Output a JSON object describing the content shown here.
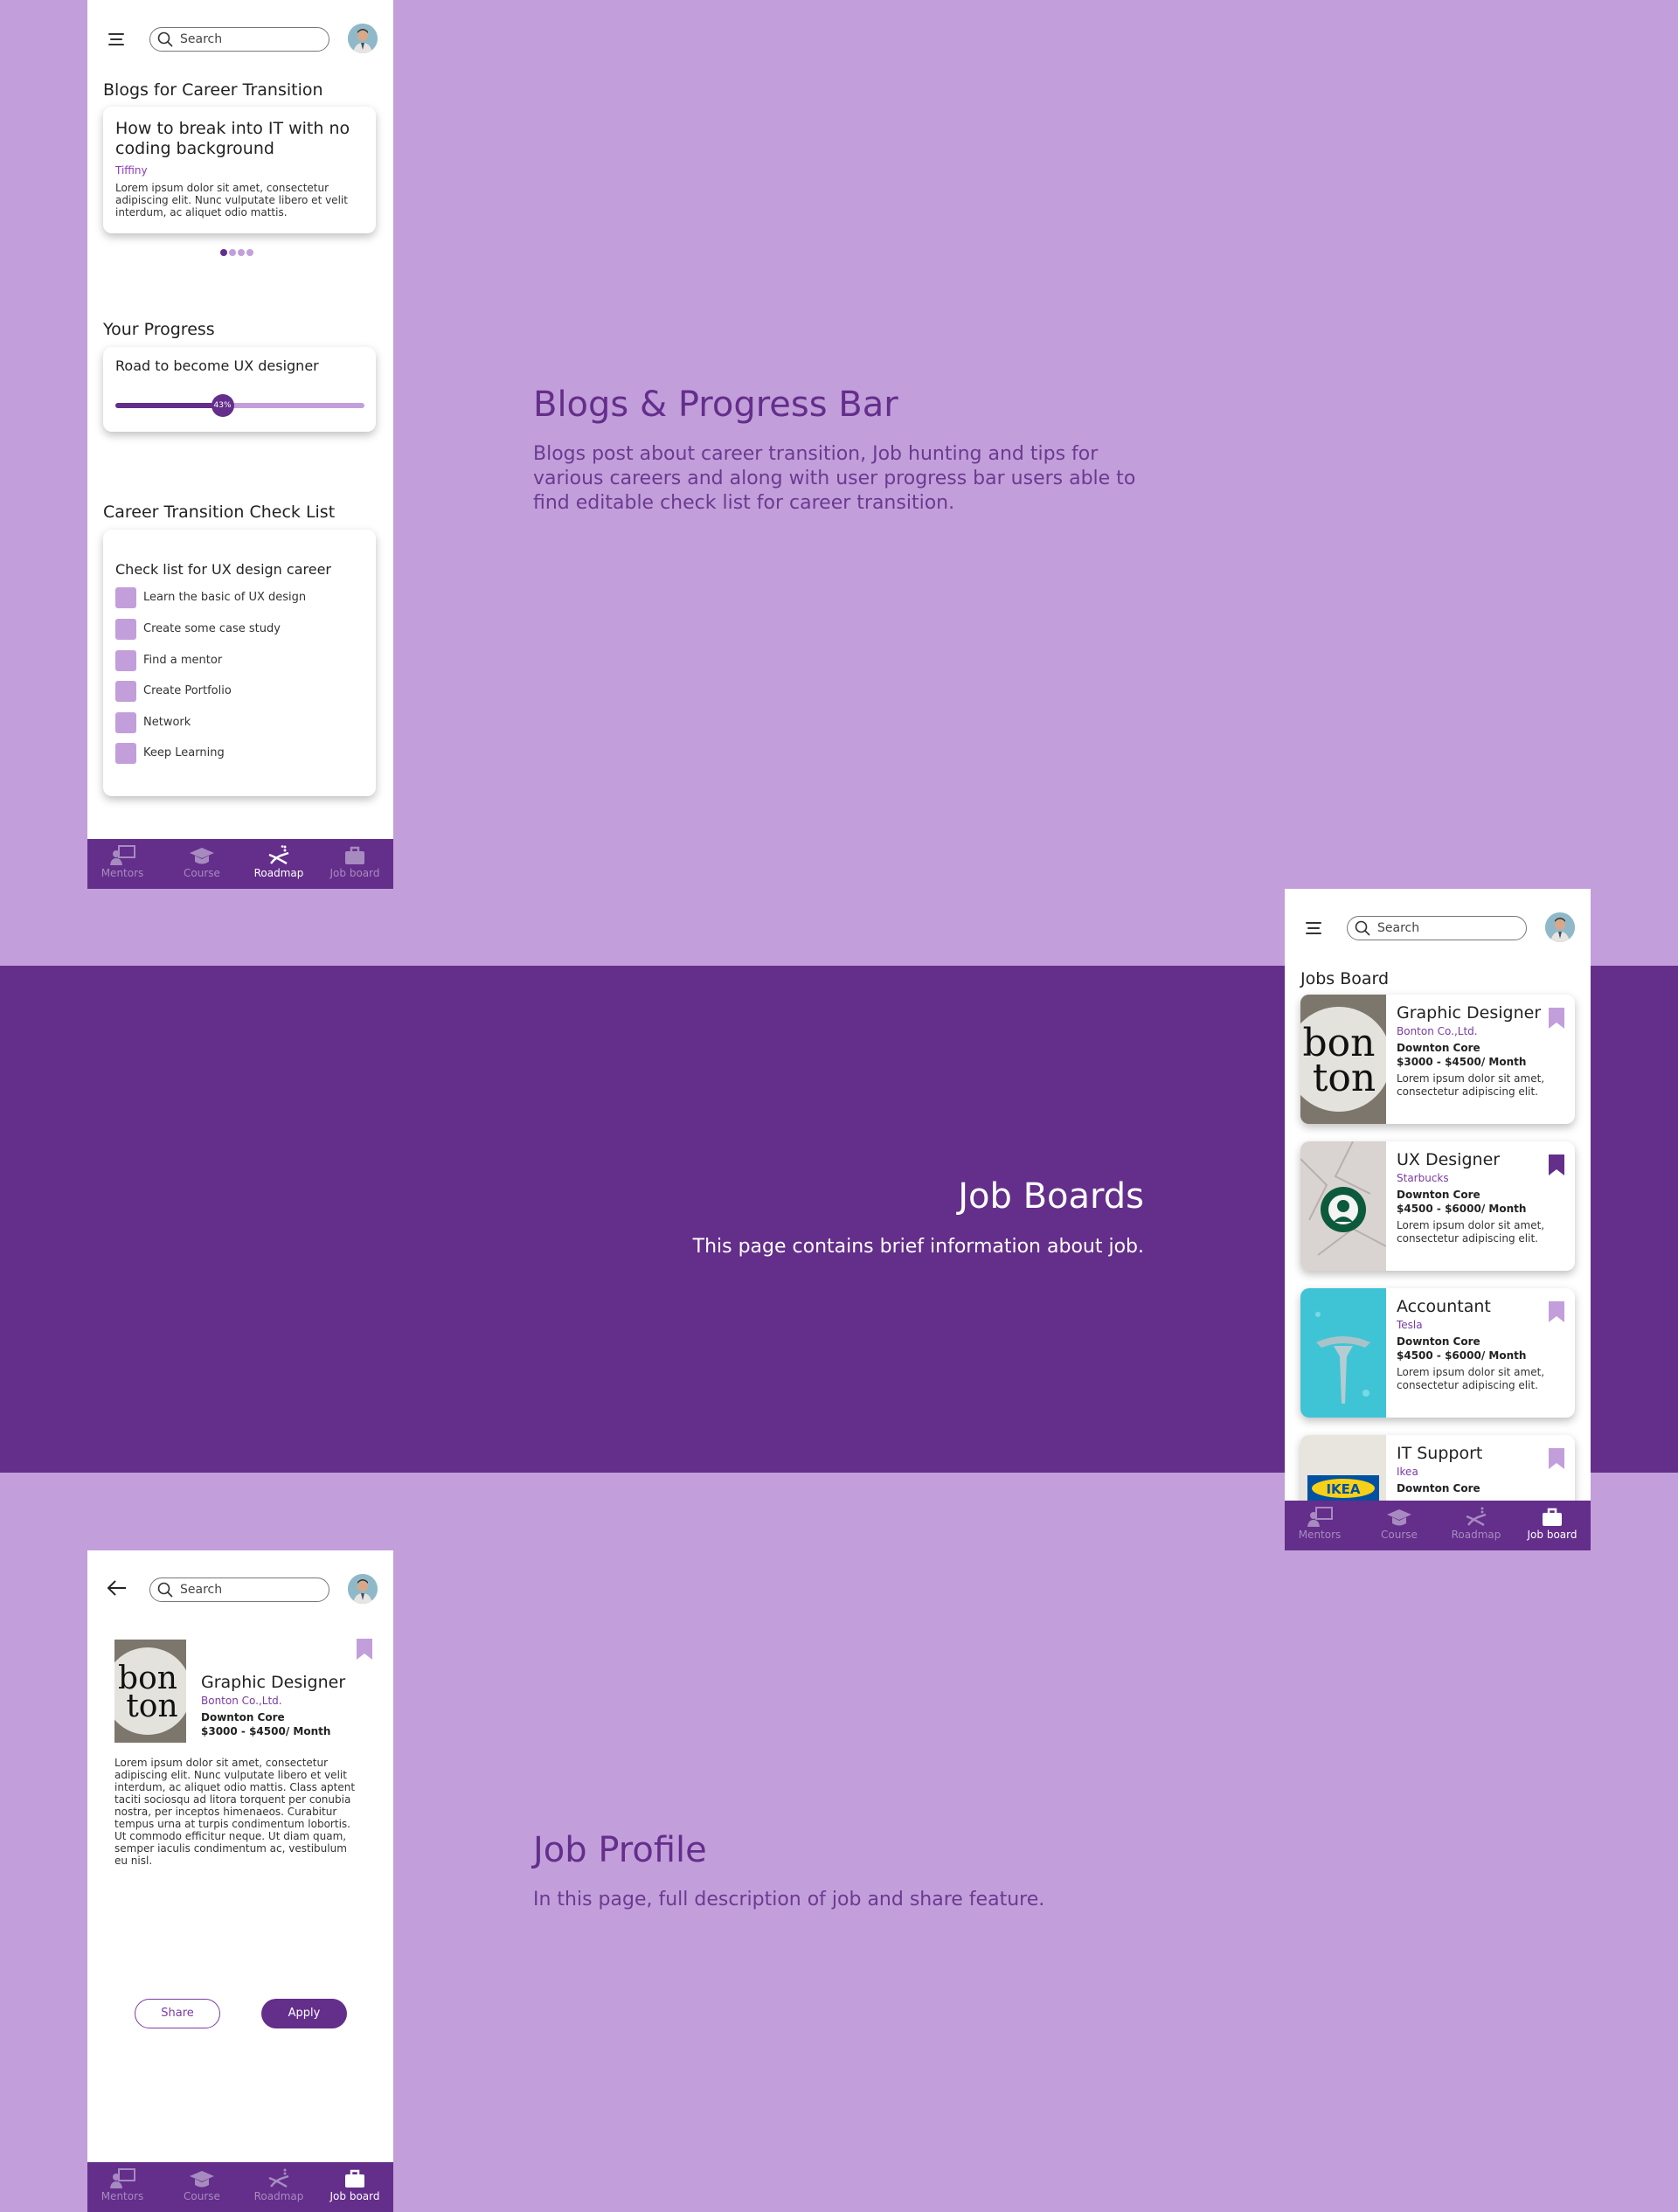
{
  "search_placeholder": "Search",
  "nav": [
    "Mentors",
    "Course",
    "Roadmap",
    "Job board"
  ],
  "section1": {
    "title": "Blogs & Progress Bar",
    "text_lines": [
      "Blogs post about career transition, Job hunting and tips for",
      "various careers and along with user progress bar users able to",
      "find editable check list for career transition."
    ]
  },
  "section2": {
    "title": "Job Boards",
    "text": "This page contains brief information about job."
  },
  "section3": {
    "title": "Job Profile",
    "text": "In this page, full description of job and share feature."
  },
  "screen1": {
    "blogs_heading": "Blogs for Career Transition",
    "blog": {
      "title_lines": [
        "How to break into IT with no",
        "coding background"
      ],
      "author": "Tiffiny",
      "body_lines": [
        "Lorem ipsum dolor sit amet, consectetur",
        "adipiscing elit. Nunc vulputate libero et velit",
        "interdum, ac aliquet odio mattis."
      ]
    },
    "carousel_active": 1,
    "carousel_count": 4,
    "progress_heading": "Your Progress",
    "progress_title": "Road to become UX designer",
    "progress_value": 43,
    "progress_label": "43%",
    "checklist_heading": "Career Transition Check List",
    "checklist_title": "Check list for UX design career",
    "checklist_items": [
      "Learn the basic of UX design",
      "Create some case study",
      "Find a mentor",
      "Create Portfolio",
      "Network",
      "Keep Learning"
    ],
    "active_nav": "Roadmap"
  },
  "screen2": {
    "heading": "Jobs Board",
    "jobs": [
      {
        "title": "Graphic Designer",
        "company": "Bonton Co.,Ltd.",
        "location": "Downton Core",
        "salary": "$3000 - $4500/ Month",
        "desc_lines": [
          "Lorem ipsum dolor sit amet,",
          "consectetur adipiscing elit."
        ],
        "saved": false,
        "logo": "bonton"
      },
      {
        "title": "UX Designer",
        "company": "Starbucks",
        "location": "Downton Core",
        "salary": "$4500 - $6000/ Month",
        "desc_lines": [
          "Lorem ipsum dolor sit amet,",
          "consectetur adipiscing elit."
        ],
        "saved": true,
        "logo": "starbucks"
      },
      {
        "title": "Accountant",
        "company": "Tesla",
        "location": "Downton Core",
        "salary": "$4500 - $6000/ Month",
        "desc_lines": [
          "Lorem ipsum dolor sit amet,",
          "consectetur adipiscing elit."
        ],
        "saved": false,
        "logo": "tesla"
      },
      {
        "title": "IT Support",
        "company": "Ikea",
        "location": "Downton Core",
        "salary": "",
        "desc_lines": [],
        "saved": false,
        "logo": "ikea"
      }
    ],
    "ikea_text": "IKEA",
    "active_nav": "Job board"
  },
  "screen3": {
    "title": "Graphic Designer",
    "company": "Bonton Co.,Ltd.",
    "location": "Downton Core",
    "salary": "$3000 - $4500/ Month",
    "body_lines": [
      "Lorem ipsum dolor sit amet, consectetur",
      "adipiscing elit. Nunc vulputate libero et velit",
      "interdum, ac aliquet odio mattis. Class aptent",
      "taciti sociosqu ad litora torquent per conubia",
      "nostra, per inceptos himenaeos. Curabitur",
      "tempus urna at turpis condimentum lobortis.",
      "Ut commodo efficitur neque. Ut diam quam,",
      "semper iaculis condimentum ac, vestibulum",
      "eu nisl."
    ],
    "share_label": "Share",
    "apply_label": "Apply",
    "active_nav": "Job board"
  },
  "colors": {
    "page_bg": "#c29fdb",
    "band": "#642e8b",
    "accent": "#642e8b",
    "light_accent": "#c29fdb",
    "company_text": "#7a3ba3"
  },
  "logo_text": {
    "bonton": [
      "bon",
      "ton"
    ]
  }
}
